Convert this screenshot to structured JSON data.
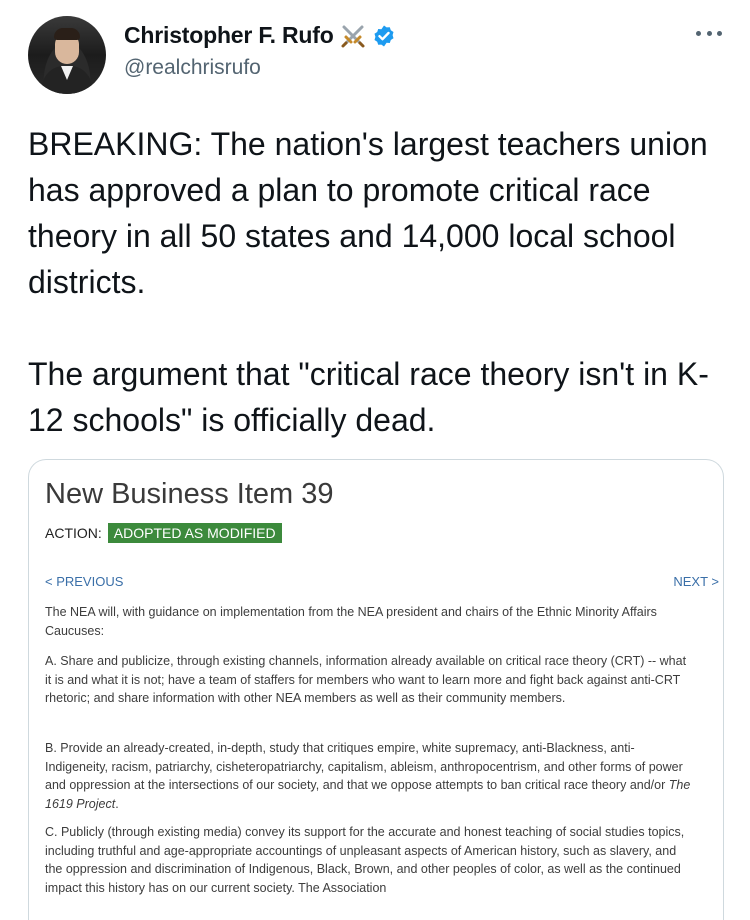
{
  "author": {
    "name": "Christopher F. Rufo",
    "handle": "@realchrisrufo",
    "name_emoji": "crossed-swords-emoji",
    "verified": true,
    "verified_color": "#1d9bf0"
  },
  "tweet": {
    "paragraphs": [
      "BREAKING: The nation's largest teachers union has approved a plan to promote critical race theory in all 50 states and 14,000 local school districts.",
      "The argument that \"critical race theory isn't in K-12 schools\" is officially dead."
    ]
  },
  "card": {
    "title": "New Business Item 39",
    "action_label": "ACTION:",
    "action_status": "ADOPTED AS MODIFIED",
    "action_status_color": "#3c8a3c",
    "prev_label": "< PREVIOUS",
    "next_label": "NEXT >",
    "intro": "The NEA will, with guidance on implementation from the NEA president and chairs of the Ethnic Minority Affairs Caucuses:",
    "item_a": "A. Share and publicize, through existing channels, information already available on critical race theory (CRT) -- what it is and what it is not; have a team of staffers for members who want to learn more and fight back against anti-CRT rhetoric; and share information with other NEA members as well as their community members.",
    "item_b_main": "B. Provide an already-created, in-depth, study that critiques empire, white supremacy, anti-Blackness, anti-Indigeneity, racism, patriarchy, cisheteropatriarchy, capitalism, ableism, anthropocentrism, and other forms of power and oppression at the intersections of our society, and that we oppose attempts to ban critical race theory and/or",
    "item_b_title": "The 1619 Project",
    "item_b_end": ".",
    "item_c": "C. Publicly (through existing media) convey its support for the accurate and honest teaching of social studies topics, including truthful and age-appropriate accountings of unpleasant aspects of American history, such as slavery, and the oppression and discrimination of Indigenous, Black, Brown, and other peoples of color, as well as the continued impact this history has on our current society. The Association"
  },
  "icons": {
    "more": "more-options-icon",
    "verified": "verified-badge-icon"
  }
}
